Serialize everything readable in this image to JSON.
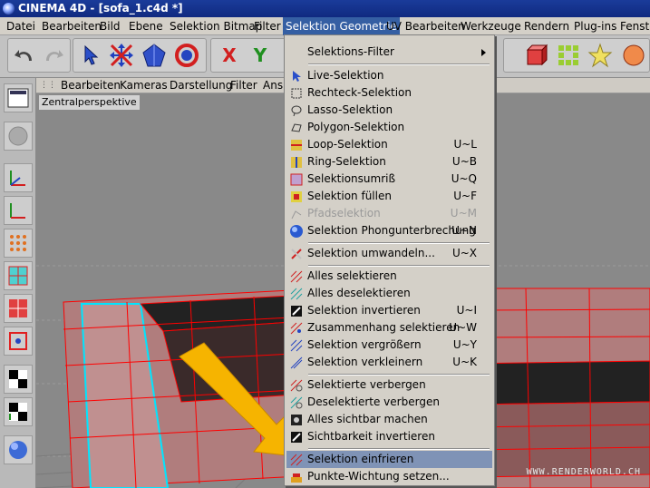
{
  "window": {
    "title": "CINEMA 4D - [sofa_1.c4d *]"
  },
  "menubar": [
    "Datei",
    "Bearbeiten",
    "Bild",
    "Ebene",
    "Selektion Bitmap",
    "Filter",
    "Selektion Geometrie",
    "UV Bearbeiten",
    "Werkzeuge",
    "Rendern",
    "Plug-ins",
    "Fenster"
  ],
  "toolbar": {
    "axis_x": "X",
    "axis_y": "Y"
  },
  "viewport_menu": [
    "Bearbeiten",
    "Kameras",
    "Darstellung",
    "Filter",
    "Ansi"
  ],
  "viewport": {
    "label": "Zentralperspektive",
    "watermark": "WWW.RENDERWORLD.CH"
  },
  "dropdown": {
    "items": [
      {
        "label": "Selektions-Filter",
        "shortcut": "",
        "submenu": true,
        "icon": "none-icon"
      },
      {
        "label": "Live-Selektion",
        "shortcut": "",
        "icon": "cursor-icon"
      },
      {
        "label": "Rechteck-Selektion",
        "shortcut": "",
        "icon": "rectangle-selection-icon"
      },
      {
        "label": "Lasso-Selektion",
        "shortcut": "",
        "icon": "lasso-icon"
      },
      {
        "label": "Polygon-Selektion",
        "shortcut": "",
        "icon": "polygon-selection-icon"
      },
      {
        "label": "Loop-Selektion",
        "shortcut": "U~L",
        "icon": "loop-selection-icon"
      },
      {
        "label": "Ring-Selektion",
        "shortcut": "U~B",
        "icon": "ring-selection-icon"
      },
      {
        "label": "Selektionsumriß",
        "shortcut": "U~Q",
        "icon": "outline-selection-icon"
      },
      {
        "label": "Selektion füllen",
        "shortcut": "U~F",
        "icon": "fill-selection-icon"
      },
      {
        "label": "Pfadselektion",
        "shortcut": "U~M",
        "disabled": true,
        "icon": "path-selection-icon"
      },
      {
        "label": "Selektion Phongunterbrechung",
        "shortcut": "U~N",
        "icon": "phong-break-icon"
      },
      {
        "label": "Selektion umwandeln...",
        "shortcut": "U~X",
        "icon": "convert-selection-icon"
      },
      {
        "label": "Alles selektieren",
        "shortcut": "",
        "icon": "select-all-icon"
      },
      {
        "label": "Alles deselektieren",
        "shortcut": "",
        "icon": "deselect-all-icon"
      },
      {
        "label": "Selektion invertieren",
        "shortcut": "U~I",
        "icon": "invert-selection-icon"
      },
      {
        "label": "Zusammenhang selektieren",
        "shortcut": "U~W",
        "icon": "select-connected-icon"
      },
      {
        "label": "Selektion vergrößern",
        "shortcut": "U~Y",
        "icon": "grow-selection-icon"
      },
      {
        "label": "Selektion verkleinern",
        "shortcut": "U~K",
        "icon": "shrink-selection-icon"
      },
      {
        "label": "Selektierte verbergen",
        "shortcut": "",
        "icon": "hide-selected-icon"
      },
      {
        "label": "Deselektierte verbergen",
        "shortcut": "",
        "icon": "hide-deselected-icon"
      },
      {
        "label": "Alles sichtbar machen",
        "shortcut": "",
        "icon": "unhide-all-icon"
      },
      {
        "label": "Sichtbarkeit invertieren",
        "shortcut": "",
        "icon": "invert-visibility-icon"
      },
      {
        "label": "Selektion einfrieren",
        "shortcut": "",
        "icon": "freeze-selection-icon",
        "highlighted": true
      },
      {
        "label": "Punkte-Wichtung setzen...",
        "shortcut": "",
        "icon": "point-weight-icon"
      }
    ]
  },
  "colors": {
    "accent": "#355fa3",
    "highlight": "#7f93b6",
    "menu_bg": "#d4d0c8",
    "arrow": "#f6b400",
    "wire": "#ff0000",
    "wire_selected": "#00e5ff",
    "sofa": "#b07d7d"
  }
}
